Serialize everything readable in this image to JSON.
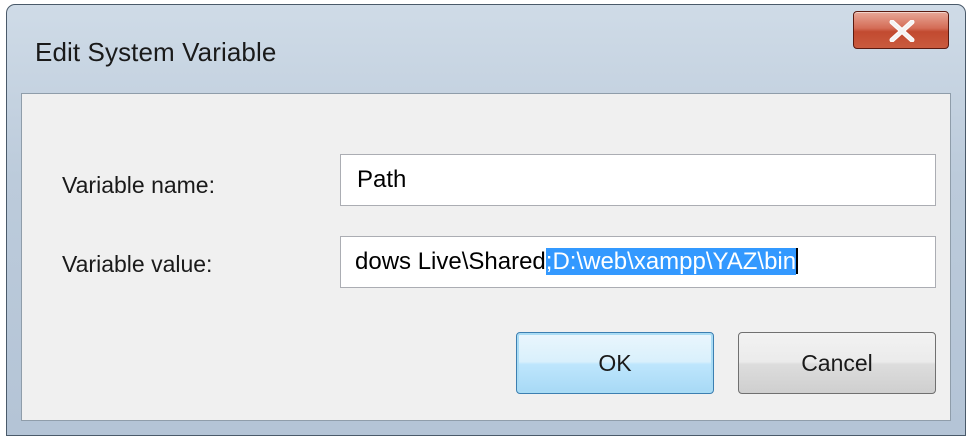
{
  "window": {
    "title": "Edit System Variable",
    "close_label": "X"
  },
  "form": {
    "name_label": "Variable name:",
    "name_value": "Path",
    "value_label": "Variable value:",
    "value_visible_unselected": "dows Live\\Shared",
    "value_visible_selected": ";D:\\web\\xampp\\YAZ\\bin"
  },
  "buttons": {
    "ok_label": "OK",
    "cancel_label": "Cancel"
  },
  "colors": {
    "selection": "#3399ff",
    "close_button": "#c95a3e",
    "default_button_border": "#3c7fb1"
  }
}
